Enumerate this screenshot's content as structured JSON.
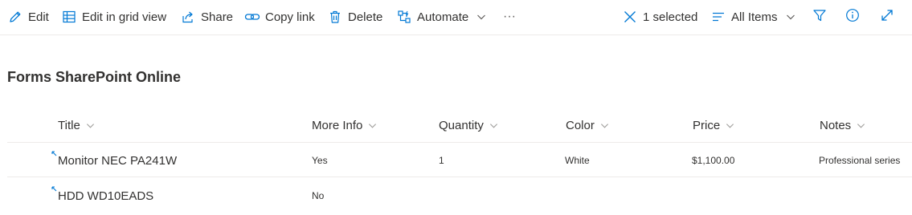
{
  "toolbar": {
    "edit": "Edit",
    "edit_grid": "Edit in grid view",
    "share": "Share",
    "copy_link": "Copy link",
    "delete": "Delete",
    "automate": "Automate",
    "more": "···",
    "selected": "1 selected",
    "view": "All Items",
    "accent": "#0078d4"
  },
  "list": {
    "title": "Forms SharePoint Online",
    "columns": [
      "Title",
      "More Info",
      "Quantity",
      "Color",
      "Price",
      "Notes"
    ],
    "rows": [
      {
        "title": "Monitor NEC PA241W",
        "more_info": "Yes",
        "quantity": "1",
        "color": "White",
        "price": "$1,100.00",
        "notes": "Professional series"
      },
      {
        "title": "HDD WD10EADS",
        "more_info": "No",
        "quantity": "",
        "color": "",
        "price": "",
        "notes": ""
      }
    ]
  }
}
